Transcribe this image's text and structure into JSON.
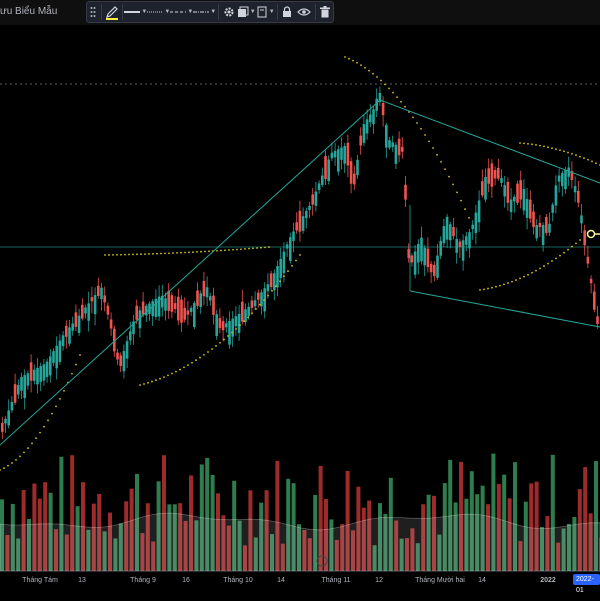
{
  "header": {
    "template_label": "ưu Biểu Mẫu"
  },
  "toolbar": {
    "icons": [
      "drag-handle-icon",
      "pencil-icon",
      "line-style-solid-icon",
      "line-style-dashed-icon",
      "line-style-dotted-icon",
      "line-style-dashdot-icon",
      "settings-gear-icon",
      "layers-icon",
      "clone-icon",
      "lock-icon",
      "eye-icon",
      "trash-icon"
    ],
    "accent": "#ffeb3b"
  },
  "axis": {
    "ticks": [
      "Tháng Tám",
      "13",
      "Tháng 9",
      "16",
      "Tháng 10",
      "14",
      "Tháng 11",
      "12",
      "Tháng Mười hai",
      "14",
      "2022"
    ],
    "bold_ticks": [
      "2022"
    ],
    "current_date_badge": "2022-01"
  },
  "colors": {
    "up": "#26a69a",
    "down": "#ef5350",
    "vol_up": "#2e7d4f",
    "vol_down": "#9e2b2b",
    "trend": "#26a69a",
    "dots": "#d4c21a",
    "bg": "#000000"
  },
  "chart_data": {
    "type": "candlestick",
    "indicators": [
      "Parabolic SAR",
      "Volume"
    ],
    "drawings": [
      "trend line",
      "horizontal line",
      "parallel channel"
    ]
  }
}
